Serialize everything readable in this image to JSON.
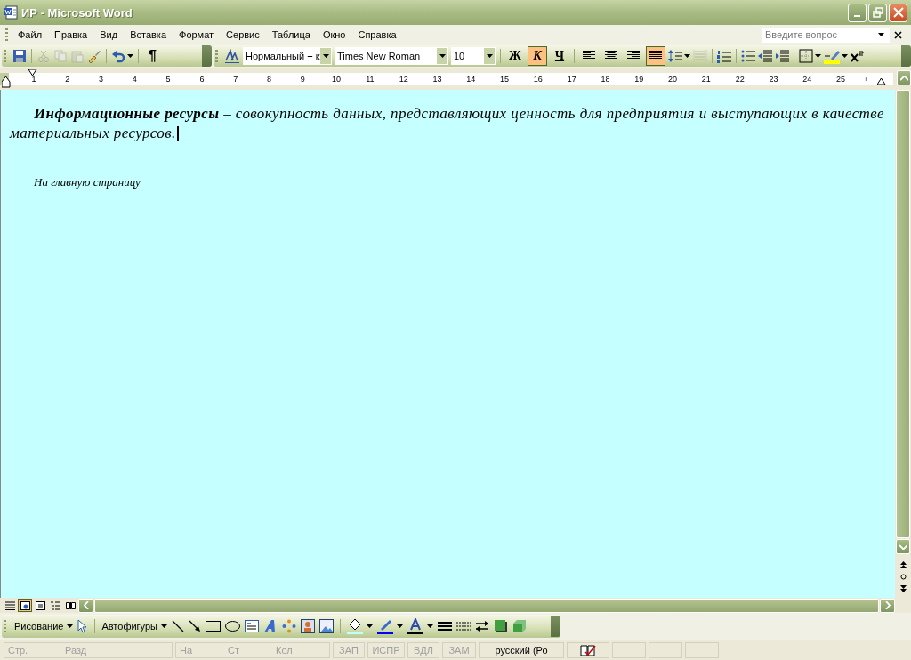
{
  "window": {
    "title": "ИР - Microsoft Word"
  },
  "menu": [
    {
      "label": "Файл"
    },
    {
      "label": "Правка"
    },
    {
      "label": "Вид"
    },
    {
      "label": "Вставка"
    },
    {
      "label": "Формат"
    },
    {
      "label": "Сервис"
    },
    {
      "label": "Таблица"
    },
    {
      "label": "Окно"
    },
    {
      "label": "Справка"
    }
  ],
  "help_box": {
    "placeholder": "Введите вопрос"
  },
  "toolbar": {
    "pilcrow": "¶",
    "style": "Нормальный + к",
    "font": "Times New Roman",
    "size": "10",
    "format_buttons": [
      {
        "label": "Ж",
        "kind": "bold",
        "selected": false
      },
      {
        "label": "К",
        "kind": "italic",
        "selected": true
      },
      {
        "label": "Ч",
        "kind": "underline",
        "selected": false
      }
    ],
    "align_buttons": [
      {
        "kind": "left",
        "selected": false
      },
      {
        "kind": "center",
        "selected": false
      },
      {
        "kind": "right",
        "selected": false
      },
      {
        "kind": "justify",
        "selected": true
      }
    ]
  },
  "ruler": [
    "1",
    "2",
    "3",
    "4",
    "5",
    "6",
    "7",
    "8",
    "9",
    "10",
    "11",
    "12",
    "13",
    "14",
    "15",
    "16",
    "17",
    "18",
    "19",
    "20",
    "21",
    "22",
    "23",
    "24",
    "25"
  ],
  "document": {
    "paragraphs": [
      {
        "kind": "definition",
        "text": "**Информационные ресурсы** – совокупность данных, представляющих ценность для предприятия и выступающих в качестве материальных ресурсов."
      },
      {
        "kind": "link",
        "text": "На главную страницу"
      }
    ]
  },
  "view_buttons": [
    {
      "kind": "normal",
      "selected": false
    },
    {
      "kind": "web",
      "selected": true
    },
    {
      "kind": "print",
      "selected": false
    },
    {
      "kind": "outline",
      "selected": false
    },
    {
      "kind": "reading",
      "selected": false
    }
  ],
  "drawing_toolbar": {
    "draw_menu": "Рисование",
    "autoshapes": "Автофигуры"
  },
  "status_bar": [
    {
      "label": "Стр.",
      "disabled": true
    },
    {
      "label": "Разд",
      "disabled": true
    },
    {
      "label": "На",
      "disabled": true
    },
    {
      "label": "Ст",
      "disabled": true
    },
    {
      "label": "Кол",
      "disabled": true
    },
    {
      "label": "ЗАП",
      "disabled": true
    },
    {
      "label": "ИСПР",
      "disabled": true
    },
    {
      "label": "ВДЛ",
      "disabled": true
    },
    {
      "label": "ЗАМ",
      "disabled": true
    },
    {
      "label": "русский (Ро",
      "disabled": false
    }
  ]
}
